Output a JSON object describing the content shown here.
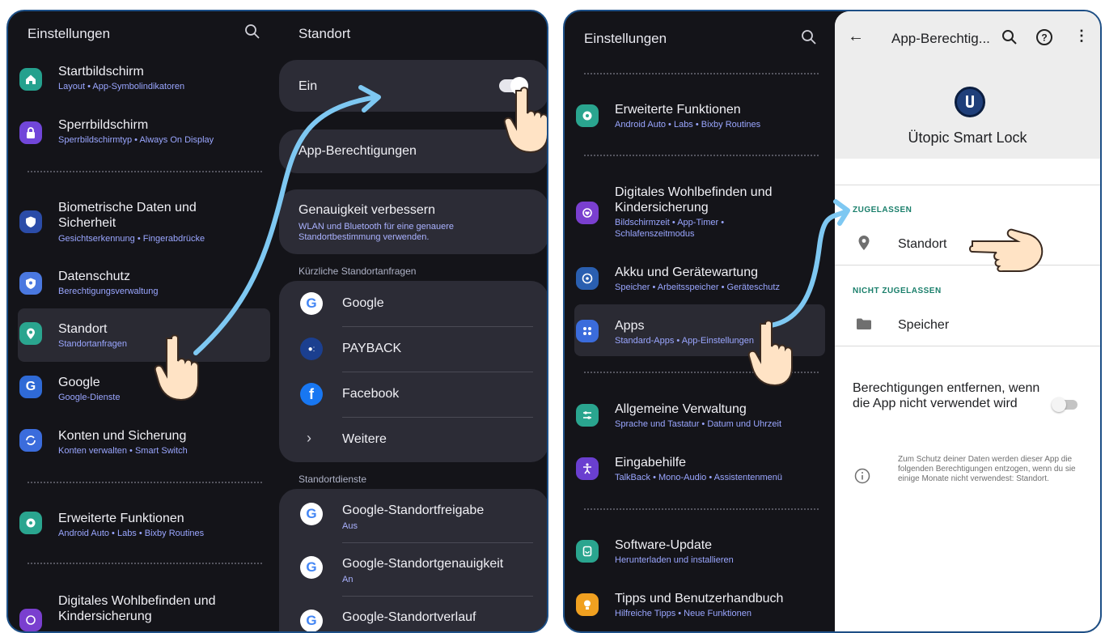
{
  "left_settings": {
    "title": "Einstellungen",
    "items": [
      {
        "title": "Startbildschirm",
        "sub": "Layout  •  App-Symbolindikatoren"
      },
      {
        "title": "Sperrbildschirm",
        "sub": "Sperrbildschirmtyp  •  Always On Display"
      },
      {
        "title": "Biometrische Daten und Sicherheit",
        "sub": "Gesichtserkennung  •  Fingerabdrücke"
      },
      {
        "title": "Datenschutz",
        "sub": "Berechtigungsverwaltung"
      },
      {
        "title": "Standort",
        "sub": "Standortanfragen"
      },
      {
        "title": "Google",
        "sub": "Google-Dienste"
      },
      {
        "title": "Konten und Sicherung",
        "sub": "Konten verwalten  •  Smart Switch"
      },
      {
        "title": "Erweiterte Funktionen",
        "sub": "Android Auto  •  Labs  •  Bixby Routines"
      },
      {
        "title": "Digitales Wohlbefinden und Kindersicherung",
        "sub": ""
      }
    ]
  },
  "standort": {
    "title": "Standort",
    "toggle_label": "Ein",
    "toggle_on": true,
    "app_permissions": "App-Berechtigungen",
    "accuracy_title": "Genauigkeit verbessern",
    "accuracy_sub": "WLAN und Bluetooth für eine genauere Standortbestimmung verwenden.",
    "recent_header": "Kürzliche Standortanfragen",
    "recent": [
      "Google",
      "PAYBACK",
      "Facebook",
      "Weitere"
    ],
    "services_header": "Standortdienste",
    "services": [
      {
        "title": "Google-Standortfreigabe",
        "sub": "Aus"
      },
      {
        "title": "Google-Standortgenauigkeit",
        "sub": "An"
      },
      {
        "title": "Google-Standortverlauf",
        "sub": ""
      }
    ]
  },
  "right_settings": {
    "title": "Einstellungen",
    "items": [
      {
        "title": "Erweiterte Funktionen",
        "sub": "Android Auto  •  Labs  •  Bixby Routines"
      },
      {
        "title": "Digitales Wohlbefinden und Kindersicherung",
        "sub": "Bildschirmzeit  •  App-Timer  •  Schlafenszeitmodus"
      },
      {
        "title": "Akku und Gerätewartung",
        "sub": "Speicher  •  Arbeitsspeicher  •  Geräteschutz"
      },
      {
        "title": "Apps",
        "sub": "Standard-Apps  •  App-Einstellungen"
      },
      {
        "title": "Allgemeine Verwaltung",
        "sub": "Sprache und Tastatur  •  Datum und Uhrzeit"
      },
      {
        "title": "Eingabehilfe",
        "sub": "TalkBack  •  Mono-Audio  •  Assistentenmenü"
      },
      {
        "title": "Software-Update",
        "sub": "Herunterladen und installieren"
      },
      {
        "title": "Tipps und Benutzerhandbuch",
        "sub": "Hilfreiche Tipps  •  Neue Funktionen"
      }
    ]
  },
  "app_permissions": {
    "title": "App-Berechtig...",
    "app_name": "Ütopic Smart Lock",
    "allowed_header": "ZUGELASSEN",
    "allowed": [
      "Standort"
    ],
    "denied_header": "NICHT ZUGELASSEN",
    "denied": [
      "Speicher"
    ],
    "remove_label": "Berechtigungen entfernen, wenn die App nicht verwendet wird",
    "remove_toggle_on": false,
    "info_text": "Zum Schutz deiner Daten werden dieser App die folgenden Berechtigungen entzogen, wenn du sie einige Monate nicht verwendest: Standort."
  },
  "colors": {
    "dark_bg": "#141419",
    "card_bg": "#2c2c36",
    "accent_sub": "#9aa6ff",
    "frame": "#1d4f86",
    "arrow": "#7ec8f2",
    "section_green": "#1a7f6b"
  }
}
